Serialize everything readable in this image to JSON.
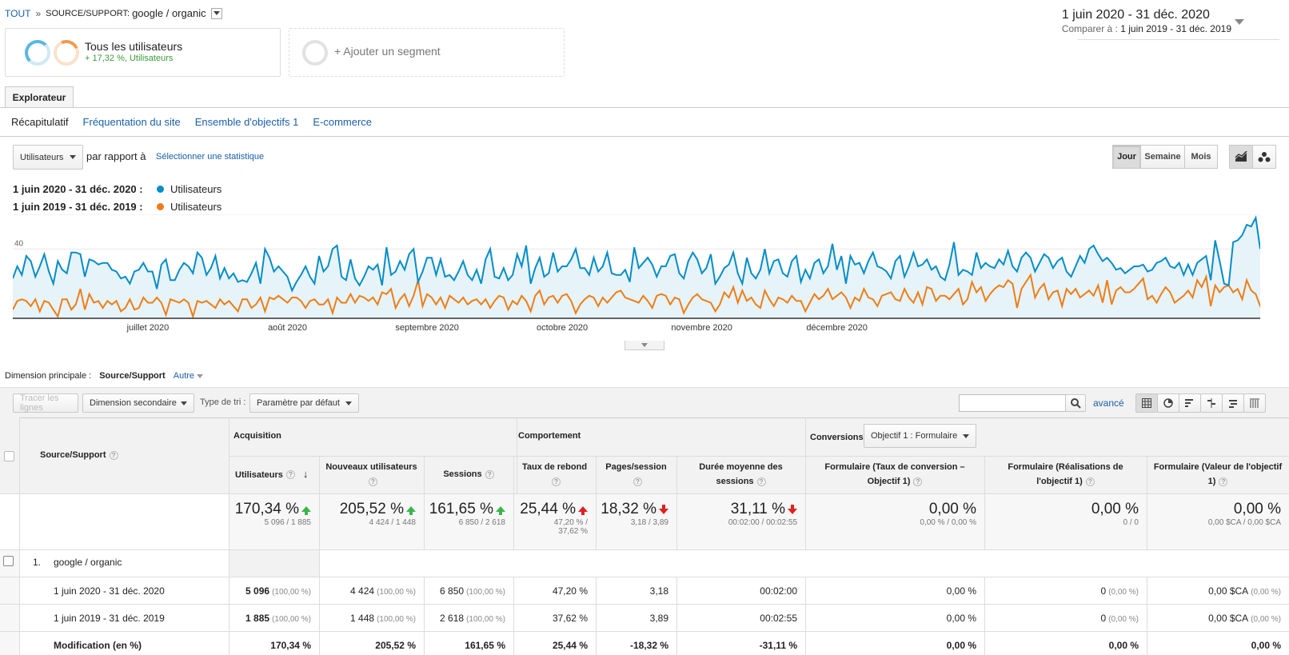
{
  "breadcrumb": {
    "root": "TOUT",
    "separator": "»",
    "key": "SOURCE/SUPPORT:",
    "value": "google / organic"
  },
  "date": {
    "main": "1 juin 2020 - 31 déc. 2020",
    "compare_label": "Comparer à :",
    "compare_value": "1 juin 2019 - 31 déc. 2019"
  },
  "segments": {
    "all_name": "Tous les utilisateurs",
    "all_change": "+ 17,32 %, Utilisateurs",
    "add_label": "+ Ajouter un segment"
  },
  "tabs": {
    "explorer": "Explorateur"
  },
  "subtabs": [
    "Récapitulatif",
    "Fréquentation du site",
    "Ensemble d'objectifs 1",
    "E-commerce"
  ],
  "chart_controls": {
    "metric": "Utilisateurs",
    "vs": "par rapport à",
    "select_stat": "Sélectionner une statistique",
    "granularity": [
      "Jour",
      "Semaine",
      "Mois"
    ]
  },
  "legend": [
    {
      "period": "1 juin 2020 - 31 déc. 2020 :",
      "metric": "Utilisateurs",
      "color": "#058dc7"
    },
    {
      "period": "1 juin 2019 - 31 déc. 2019 :",
      "metric": "Utilisateurs",
      "color": "#ed7e17"
    }
  ],
  "chart_data": {
    "type": "line",
    "yticks": [
      "20",
      "40",
      "60"
    ],
    "ylim": [
      0,
      60
    ],
    "xticks": [
      {
        "label": "juillet 2020",
        "day": 30
      },
      {
        "label": "août 2020",
        "day": 61
      },
      {
        "label": "septembre 2020",
        "day": 92
      },
      {
        "label": "octobre 2020",
        "day": 122
      },
      {
        "label": "novembre 2020",
        "day": 153
      },
      {
        "label": "décembre 2020",
        "day": 183
      }
    ],
    "series": [
      {
        "name": "1 juin 2020 - 31 déc. 2020",
        "color": "#058dc7",
        "values": [
          23,
          30,
          25,
          36,
          33,
          24,
          30,
          37,
          27,
          20,
          33,
          28,
          26,
          38,
          38,
          37,
          24,
          34,
          33,
          31,
          32,
          32,
          28,
          27,
          23,
          24,
          20,
          27,
          28,
          32,
          27,
          27,
          17,
          31,
          34,
          22,
          22,
          28,
          32,
          30,
          26,
          38,
          35,
          25,
          29,
          36,
          23,
          29,
          23,
          26,
          21,
          22,
          21,
          26,
          32,
          20,
          40,
          35,
          27,
          30,
          27,
          24,
          16,
          21,
          25,
          30,
          24,
          20,
          36,
          27,
          30,
          40,
          42,
          24,
          22,
          34,
          23,
          19,
          24,
          30,
          28,
          31,
          19,
          41,
          25,
          27,
          33,
          28,
          37,
          40,
          21,
          27,
          35,
          35,
          25,
          34,
          24,
          25,
          22,
          27,
          33,
          25,
          22,
          28,
          20,
          34,
          40,
          24,
          23,
          29,
          22,
          25,
          37,
          30,
          42,
          20,
          29,
          35,
          24,
          26,
          38,
          27,
          30,
          30,
          34,
          40,
          29,
          29,
          25,
          35,
          27,
          30,
          38,
          26,
          25,
          25,
          28,
          21,
          41,
          29,
          32,
          35,
          31,
          24,
          30,
          30,
          36,
          37,
          26,
          23,
          33,
          38,
          34,
          26,
          29,
          37,
          20,
          24,
          29,
          31,
          38,
          26,
          20,
          35,
          26,
          23,
          28,
          40,
          26,
          33,
          34,
          26,
          24,
          33,
          36,
          21,
          28,
          23,
          32,
          34,
          26,
          30,
          43,
          28,
          36,
          20,
          36,
          31,
          32,
          26,
          33,
          38,
          30,
          29,
          27,
          23,
          33,
          36,
          24,
          30,
          38,
          30,
          31,
          34,
          28,
          30,
          24,
          22,
          31,
          44,
          25,
          28,
          27,
          25,
          38,
          29,
          32,
          30,
          29,
          34,
          31,
          39,
          30,
          27,
          35,
          38,
          35,
          27,
          32,
          37,
          35,
          29,
          33,
          35,
          27,
          24,
          30,
          36,
          32,
          40,
          42,
          37,
          33,
          35,
          32,
          28,
          29,
          26,
          28,
          30,
          30,
          31,
          27,
          28,
          32,
          33,
          35,
          30,
          29,
          32,
          25,
          31,
          25,
          32,
          34,
          36,
          22,
          45,
          33,
          20,
          19,
          44,
          45,
          48,
          54,
          53,
          58,
          40
        ]
      },
      {
        "name": "1 juin 2019 - 31 déc. 2019",
        "color": "#ed7e17",
        "values": [
          5,
          10,
          11,
          10,
          7,
          11,
          4,
          10,
          9,
          5,
          1,
          11,
          11,
          5,
          8,
          17,
          5,
          14,
          9,
          10,
          6,
          10,
          8,
          10,
          4,
          6,
          11,
          5,
          6,
          12,
          9,
          9,
          12,
          9,
          2,
          11,
          10,
          9,
          11,
          9,
          1,
          10,
          9,
          10,
          8,
          6,
          11,
          8,
          10,
          7,
          4,
          11,
          11,
          6,
          8,
          12,
          4,
          12,
          11,
          13,
          11,
          9,
          12,
          12,
          10,
          6,
          10,
          11,
          8,
          8,
          11,
          3,
          12,
          9,
          9,
          14,
          9,
          13,
          12,
          10,
          12,
          8,
          15,
          14,
          17,
          6,
          11,
          14,
          7,
          13,
          22,
          7,
          14,
          12,
          8,
          12,
          6,
          13,
          11,
          9,
          12,
          8,
          10,
          11,
          8,
          11,
          6,
          10,
          13,
          12,
          5,
          10,
          8,
          13,
          10,
          4,
          13,
          16,
          8,
          12,
          13,
          9,
          13,
          14,
          10,
          3,
          8,
          11,
          13,
          12,
          7,
          12,
          9,
          12,
          15,
          16,
          12,
          11,
          10,
          9,
          13,
          10,
          6,
          13,
          14,
          13,
          8,
          12,
          11,
          3,
          8,
          12,
          14,
          11,
          10,
          9,
          4,
          8,
          15,
          12,
          18,
          9,
          16,
          10,
          12,
          8,
          6,
          16,
          11,
          7,
          12,
          11,
          9,
          13,
          10,
          10,
          4,
          9,
          14,
          11,
          13,
          17,
          11,
          13,
          15,
          12,
          6,
          12,
          10,
          17,
          12,
          11,
          7,
          13,
          14,
          15,
          11,
          10,
          17,
          12,
          9,
          15,
          8,
          18,
          17,
          10,
          13,
          13,
          11,
          14,
          17,
          8,
          11,
          21,
          15,
          18,
          10,
          14,
          17,
          19,
          18,
          22,
          20,
          6,
          17,
          21,
          25,
          12,
          17,
          20,
          11,
          15,
          16,
          7,
          17,
          14,
          17,
          12,
          14,
          16,
          13,
          19,
          9,
          22,
          8,
          16,
          18,
          15,
          15,
          17,
          20,
          23,
          11,
          13,
          9,
          14,
          18,
          15,
          9,
          11,
          13,
          16,
          12,
          22,
          18,
          24,
          7,
          19,
          15,
          18,
          19,
          15,
          17,
          11,
          22,
          16,
          14,
          7,
          13,
          20,
          18,
          16,
          13,
          8,
          12,
          19,
          18,
          21,
          18,
          14
        ]
      }
    ]
  },
  "dimension": {
    "label": "Dimension principale :",
    "current": "Source/Support",
    "other": "Autre"
  },
  "toolbar": {
    "plot_rows": "Tracer les lignes",
    "secondary": "Dimension secondaire",
    "sort_label": "Type de tri :",
    "sort_value": "Paramètre par défaut",
    "advanced": "avancé",
    "search_placeholder": ""
  },
  "table": {
    "dim_header": "Source/Support",
    "groups": {
      "acq": "Acquisition",
      "beh": "Comportement",
      "conv": "Conversions",
      "goal_select": "Objectif 1 : Formulaire"
    },
    "columns": [
      "Utilisateurs",
      "Nouveaux utilisateurs",
      "Sessions",
      "Taux de rebond",
      "Pages/session",
      "Durée moyenne des sessions",
      "Formulaire (Taux de conversion – Objectif 1)",
      "Formulaire (Réalisations de l'objectif 1)",
      "Formulaire (Valeur de l'objectif 1)"
    ],
    "totals": [
      {
        "big": "170,34 %",
        "sub": "5 096 / 1 885",
        "trend": "up"
      },
      {
        "big": "205,52 %",
        "sub": "4 424 / 1 448",
        "trend": "up"
      },
      {
        "big": "161,65 %",
        "sub": "6 850 / 2 618",
        "trend": "up"
      },
      {
        "big": "25,44 %",
        "sub": "47,20 % /",
        "sub2": "37,62 %",
        "trend": "upr"
      },
      {
        "big": "18,32 %",
        "sub": "3,18 / 3,89",
        "trend": "dn"
      },
      {
        "big": "31,11 %",
        "sub": "00:02:00 / 00:02:55",
        "trend": "dn"
      },
      {
        "big": "0,00 %",
        "sub": "0,00 % / 0,00 %",
        "trend": ""
      },
      {
        "big": "0,00 %",
        "sub": "0 / 0",
        "trend": ""
      },
      {
        "big": "0,00 %",
        "sub": "0,00 $CA / 0,00 $CA",
        "trend": ""
      }
    ],
    "row_index": "1.",
    "row_name": "google / organic",
    "sub_rows": [
      {
        "label": "1 juin 2020 - 31 déc. 2020",
        "cells": [
          [
            "5 096",
            "(100,00 %)"
          ],
          [
            "4 424",
            "(100,00 %)"
          ],
          [
            "6 850",
            "(100,00 %)"
          ],
          [
            "47,20 %",
            ""
          ],
          [
            "3,18",
            ""
          ],
          [
            "00:02:00",
            ""
          ],
          [
            "0,00 %",
            ""
          ],
          [
            "0",
            "(0,00 %)"
          ],
          [
            "0,00 $CA",
            "(0,00 %)"
          ]
        ]
      },
      {
        "label": "1 juin 2019 - 31 déc. 2019",
        "cells": [
          [
            "1 885",
            "(100,00 %)"
          ],
          [
            "1 448",
            "(100,00 %)"
          ],
          [
            "2 618",
            "(100,00 %)"
          ],
          [
            "37,62 %",
            ""
          ],
          [
            "3,89",
            ""
          ],
          [
            "00:02:55",
            ""
          ],
          [
            "0,00 %",
            ""
          ],
          [
            "0",
            "(0,00 %)"
          ],
          [
            "0,00 $CA",
            "(0,00 %)"
          ]
        ]
      },
      {
        "label": "Modification (en %)",
        "cells": [
          [
            "170,34 %",
            ""
          ],
          [
            "205,52 %",
            ""
          ],
          [
            "161,65 %",
            ""
          ],
          [
            "25,44 %",
            ""
          ],
          [
            "-18,32 %",
            ""
          ],
          [
            "-31,11 %",
            ""
          ],
          [
            "0,00 %",
            ""
          ],
          [
            "0,00 %",
            ""
          ],
          [
            "0,00 %",
            ""
          ]
        ]
      }
    ]
  }
}
